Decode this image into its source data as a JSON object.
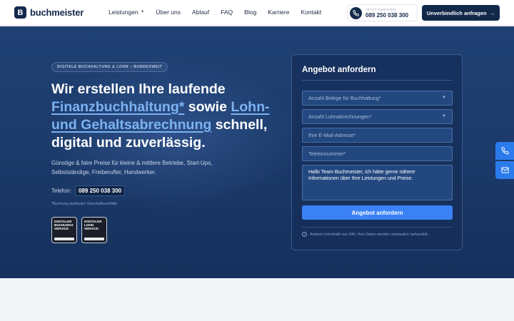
{
  "brand": {
    "logo_letter": "B",
    "name": "buchmeister"
  },
  "nav": {
    "items": [
      "Leistungen",
      "Über uns",
      "Ablauf",
      "FAQ",
      "Blog",
      "Karriere",
      "Kontakt"
    ]
  },
  "header": {
    "phone_caption": "JETZT ANRUFEN",
    "phone_number": "089 250 038 300",
    "cta_label": "Unverbindlich anfragen",
    "cta_arrow": "→"
  },
  "hero": {
    "badge": "DIGITALE BUCHHALTUNG & LOHN – BUNDESWEIT",
    "headline_1": "Wir erstellen Ihre laufende",
    "headline_link_1": "Finanzbuchhaltung*",
    "headline_2": " sowie ",
    "headline_link_2": "Lohn- und Gehaltsabrechnung",
    "headline_3": " schnell, digital und zuverlässig.",
    "subtext": "Günstige & faire Preise für kleine & mittlere Betriebe, Start-Ups, Selbstständige, Freiberufler, Handwerker.",
    "tel_label": "Telefon:",
    "tel_number": "089 250 038 300",
    "footnote": "*Buchung laufender Geschäftsvorfälle",
    "seal_1": "DIGITALER BUCHUNGS SERVICE",
    "seal_2": "DIGITALER LOHN SERVICE"
  },
  "form": {
    "title": "Angebot anfordern",
    "select_belege": "Anzahl Belege für Buchhaltung*",
    "select_lohn": "Anzahl Lohnabrechnungen*",
    "email_placeholder": "Ihre E-Mail-Adresse*",
    "phone_placeholder": "Telefonnummer*",
    "message": "Hallo Team Buchmeister, ich hätte gerne nähere Informationen über Ihre Leistungen und Preise.",
    "submit": "Angebot anfordern",
    "hint": "Antwort innerhalb von 24h. Ihre Daten werden vertraulich behandelt."
  },
  "icons": {
    "nav_dropdown": "chevron-down-icon",
    "field_dropdown": "chevron-down-icon",
    "header_phone": "phone-icon",
    "side_phone": "phone-icon",
    "side_mail": "mail-icon",
    "hint_info": "info-icon"
  },
  "colors": {
    "navy": "#13294b",
    "hero_bg": "#1f4073",
    "accent_blue": "#3b82f6",
    "link_blue": "#7cb2f2"
  }
}
